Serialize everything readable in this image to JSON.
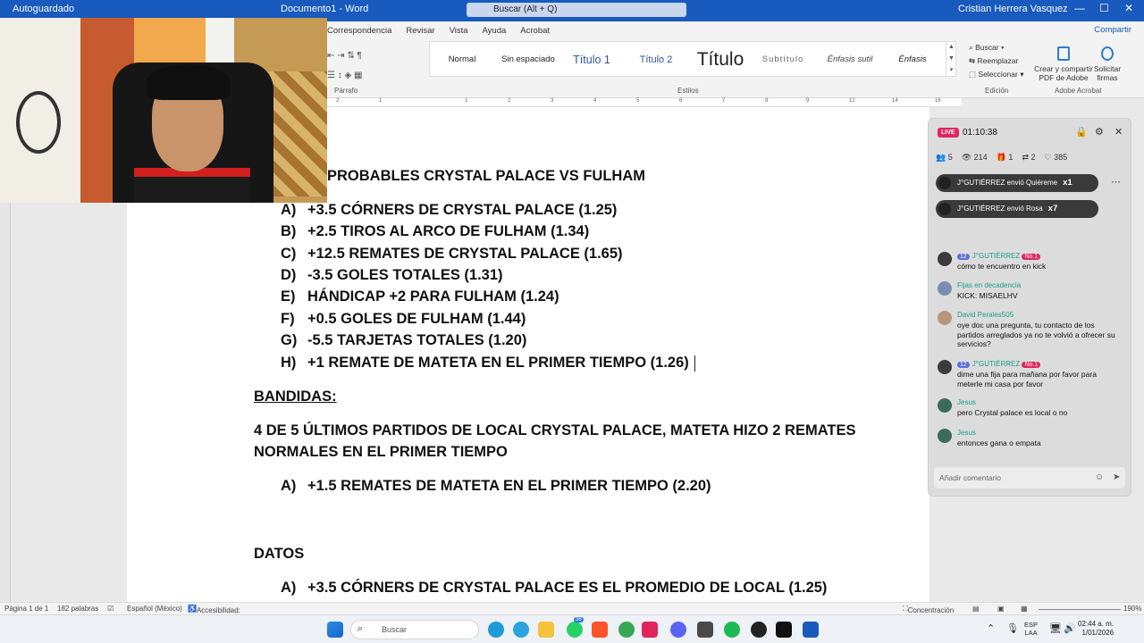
{
  "titlebar": {
    "autosave": "Autoguardado",
    "doc_title": "Documento1 - Word",
    "search": "Buscar (Alt + Q)",
    "user": "Cristian Herrera Vasquez",
    "minimize": "—",
    "maximize": "☐",
    "close": "✕"
  },
  "ribbon": {
    "tabs": [
      "Correspondencia",
      "Revisar",
      "Vista",
      "Ayuda",
      "Acrobat"
    ],
    "share": "Compartir",
    "styles": [
      "Normal",
      "Sin espaciado",
      "Título 1",
      "Título 2",
      "Título",
      "Subtítulo",
      "Énfasis sutil",
      "Énfasis"
    ],
    "groups": {
      "paragraph": "Párrafo",
      "styles": "Estilos",
      "editing": "Edición",
      "adobe": "Adobe Acrobat"
    },
    "editing": {
      "find": "Buscar",
      "replace": "Reemplazar",
      "select": "Seleccionar"
    },
    "adobe": {
      "create": "Crear y compartir PDF de Adobe",
      "sign": "Solicitar firmas"
    }
  },
  "ruler": [
    "2",
    "1",
    "1",
    "2",
    "3",
    "4",
    "5",
    "6",
    "7",
    "8",
    "9",
    "10",
    "11",
    "12",
    "13",
    "14",
    "15",
    "16",
    "17"
  ],
  "document": {
    "heading": "PROBABLES CRYSTAL PALACE VS FULHAM",
    "items": [
      {
        "letter": "A)",
        "text": "+3.5 CÓRNERS DE CRYSTAL PALACE (1.25)"
      },
      {
        "letter": "B)",
        "text": "+2.5 TIROS AL ARCO DE FULHAM (1.34)"
      },
      {
        "letter": "C)",
        "text": "+12.5 REMATES DE CRYSTAL PALACE (1.65)"
      },
      {
        "letter": "D)",
        "text": "-3.5 GOLES TOTALES (1.31)"
      },
      {
        "letter": "E)",
        "text": "HÁNDICAP +2 PARA FULHAM (1.24)"
      },
      {
        "letter": "F)",
        "text": "+0.5 GOLES DE FULHAM (1.44)"
      },
      {
        "letter": "G)",
        "text": "-5.5 TARJETAS TOTALES (1.20)"
      },
      {
        "letter": "H)",
        "text": "+1 REMATE DE MATETA EN EL PRIMER TIEMPO (1.26)"
      }
    ],
    "bandidas_title": "BANDIDAS:",
    "bandidas_line1": "4 DE 5 ÚLTIMOS PARTIDOS DE LOCAL CRYSTAL PALACE, MATETA HIZO 2 REMATES",
    "bandidas_line2": "NORMALES EN EL PRIMER TIEMPO",
    "bandidas_item": {
      "letter": "A)",
      "text": "+1.5 REMATES DE MATETA EN EL PRIMER TIEMPO (2.20)"
    },
    "datos_title": "DATOS",
    "datos_item": {
      "letter": "A)",
      "text": "+3.5 CÓRNERS DE CRYSTAL PALACE ES EL PROMEDIO DE LOCAL (1.25)"
    }
  },
  "live": {
    "badge": "LIVE",
    "time": "01:10:38",
    "stats": [
      "5",
      "214",
      "1",
      "2",
      "385"
    ],
    "gifts": [
      {
        "text": "J°GUTIÉRREZ envió Quiéreme",
        "count": "x1"
      },
      {
        "text": "J°GUTIÉRREZ envió Rosa",
        "count": "x7"
      }
    ],
    "messages": [
      {
        "badge": "12",
        "name": "J°GUTIÉRREZ",
        "rank": "No.1",
        "text": "cómo te encuentro en kick"
      },
      {
        "badge": "",
        "name": "Fijas en decadencia",
        "rank": "",
        "text": "KICK: MISAELHV"
      },
      {
        "badge": "",
        "name": "David Perales505",
        "rank": "",
        "text": "oye doc una pregunta, tu contacto de los partidos arreglados ya no te volvió a ofrecer su servicios?"
      },
      {
        "badge": "12",
        "name": "J°GUTIÉRREZ",
        "rank": "No.1",
        "text": "dime una fija para mañana por favor para meterle mi casa por favor"
      },
      {
        "badge": "",
        "name": "Jesus",
        "rank": "",
        "text": "pero Crystal palace es local o no"
      },
      {
        "badge": "",
        "name": "Jesus",
        "rank": "",
        "text": "entonces gana o empata"
      }
    ],
    "comment_placeholder": "Añadir comentario"
  },
  "statusbar": {
    "page": "Página 1 de 1",
    "words": "182 palabras",
    "lang": "Español (México)",
    "access": "Accesibilidad: todo correcto",
    "focus": "Concentración",
    "zoom": "190%"
  },
  "taskbar": {
    "search": "Buscar",
    "lang": "ESP",
    "lang2": "LAA",
    "time": "02:44 a. m.",
    "date": "1/01/2026",
    "badge": "36"
  }
}
